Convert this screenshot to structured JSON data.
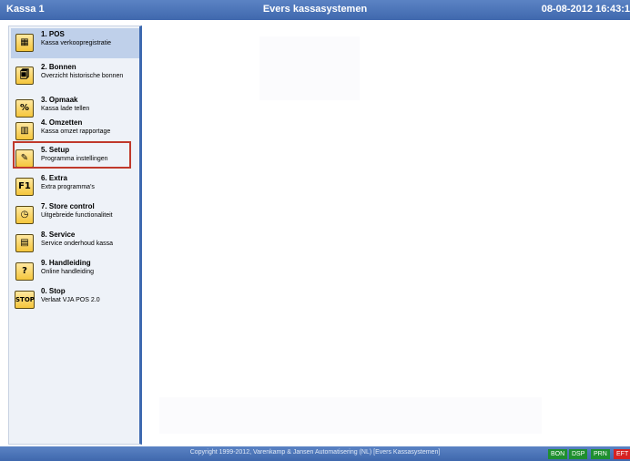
{
  "window": {
    "left_title": "Kassa 1",
    "center_title": "Evers kassasystemen",
    "datetime": "08-08-2012 16:43:1"
  },
  "sidebar": {
    "items": [
      {
        "label": "1. POS",
        "sub": "Kassa verkoopregistratie",
        "icon": "cash-register-icon",
        "glyph": "▦"
      },
      {
        "label": "2. Bonnen",
        "sub": "Overzicht historische bonnen",
        "icon": "receipt-icon",
        "glyph": "🗐"
      },
      {
        "label": "3. Opmaak",
        "sub": "Kassa lade tellen",
        "icon": "percent-icon",
        "glyph": "%"
      },
      {
        "label": "4. Omzetten",
        "sub": "Kassa omzet rapportage",
        "icon": "report-icon",
        "glyph": "▥"
      },
      {
        "label": "5. Setup",
        "sub": "Programma instellingen",
        "icon": "settings-icon",
        "glyph": "✎"
      },
      {
        "label": "6. Extra",
        "sub": "Extra programma's",
        "icon": "f1-icon",
        "glyph": "F1"
      },
      {
        "label": "7. Store control",
        "sub": "Uitgebreide functionaliteit",
        "icon": "clock-icon",
        "glyph": "◷"
      },
      {
        "label": "8. Service",
        "sub": "Service onderhoud kassa",
        "icon": "service-icon",
        "glyph": "▤"
      },
      {
        "label": "9. Handleiding",
        "sub": "Online handleiding",
        "icon": "help-icon",
        "glyph": "?"
      },
      {
        "label": "0. Stop",
        "sub": "Verlaat VJA POS 2.0",
        "icon": "stop-icon",
        "glyph": "STOP"
      }
    ]
  },
  "status": {
    "copyright": "Copyright 1999-2012, Varenkamp & Jansen Automatisering (NL) [Evers Kassasystemen]",
    "indicators": [
      {
        "label": "BON",
        "color": "#1f8f2f"
      },
      {
        "label": "DSP",
        "color": "#1f8f2f"
      },
      {
        "label": "PRN",
        "color": "#1f8f2f"
      },
      {
        "label": "EFT",
        "color": "#d62222"
      }
    ]
  }
}
